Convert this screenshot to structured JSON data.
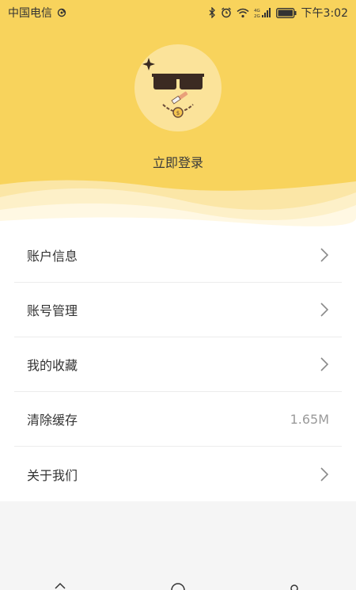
{
  "status_bar": {
    "carrier": "中国电信",
    "time": "下午3:02",
    "net_labels": [
      "4G",
      "2G"
    ]
  },
  "profile": {
    "login_text": "立即登录",
    "avatar_icon": "sunglasses-face-icon"
  },
  "menu": {
    "items": [
      {
        "label": "账户信息",
        "value": "",
        "icon": "chevron-right-icon"
      },
      {
        "label": "账号管理",
        "value": "",
        "icon": "chevron-right-icon"
      },
      {
        "label": "我的收藏",
        "value": "",
        "icon": "chevron-right-icon"
      },
      {
        "label": "清除缓存",
        "value": "1.65M"
      },
      {
        "label": "关于我们",
        "value": "",
        "icon": "chevron-right-icon"
      }
    ]
  },
  "colors": {
    "header_bg": "#f8d35c",
    "avatar_bg": "#fbe39a",
    "page_bg": "#f5f5f5"
  }
}
